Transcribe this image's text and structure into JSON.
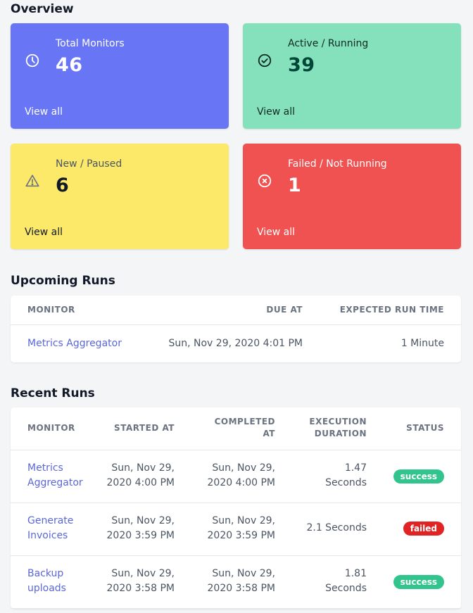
{
  "overview": {
    "title": "Overview",
    "cards": [
      {
        "label": "Total Monitors",
        "value": "46",
        "link": "View all",
        "icon": "clock-icon",
        "color": "#6875f5"
      },
      {
        "label": "Active / Running",
        "value": "39",
        "link": "View all",
        "icon": "check-circle-icon",
        "color": "#84e1bc"
      },
      {
        "label": "New / Paused",
        "value": "6",
        "link": "View all",
        "icon": "warning-icon",
        "color": "#fce96a"
      },
      {
        "label": "Failed / Not Running",
        "value": "1",
        "link": "View all",
        "icon": "x-circle-icon",
        "color": "#f05252"
      }
    ]
  },
  "upcoming": {
    "title": "Upcoming Runs",
    "headers": {
      "monitor": "MONITOR",
      "due": "DUE AT",
      "expected": "EXPECTED RUN TIME"
    },
    "rows": [
      {
        "monitor": "Metrics Aggregator",
        "due": "Sun, Nov 29, 2020 4:01 PM",
        "expected": "1 Minute"
      }
    ]
  },
  "recent": {
    "title": "Recent Runs",
    "headers": {
      "monitor": "MONITOR",
      "started": "STARTED AT",
      "completed_1": "COMPLETED",
      "completed_2": "AT",
      "duration_1": "EXECUTION",
      "duration_2": "DURATION",
      "status": "STATUS"
    },
    "rows": [
      {
        "monitor_1": "Metrics",
        "monitor_2": "Aggregator",
        "started_1": "Sun, Nov 29,",
        "started_2": "2020 4:00 PM",
        "completed_1": "Sun, Nov 29,",
        "completed_2": "2020 4:00 PM",
        "duration_1": "1.47",
        "duration_2": "Seconds",
        "status": "success"
      },
      {
        "monitor_1": "Generate",
        "monitor_2": "Invoices",
        "started_1": "Sun, Nov 29,",
        "started_2": "2020 3:59 PM",
        "completed_1": "Sun, Nov 29,",
        "completed_2": "2020 3:59 PM",
        "duration": "2.1 Seconds",
        "status": "failed"
      },
      {
        "monitor_1": "Backup",
        "monitor_2": "uploads",
        "started_1": "Sun, Nov 29,",
        "started_2": "2020 3:58 PM",
        "completed_1": "Sun, Nov 29,",
        "completed_2": "2020 3:58 PM",
        "duration_1": "1.81",
        "duration_2": "Seconds",
        "status": "success"
      }
    ],
    "status_colors": {
      "success": "#31c48d",
      "failed": "#e02424"
    }
  }
}
